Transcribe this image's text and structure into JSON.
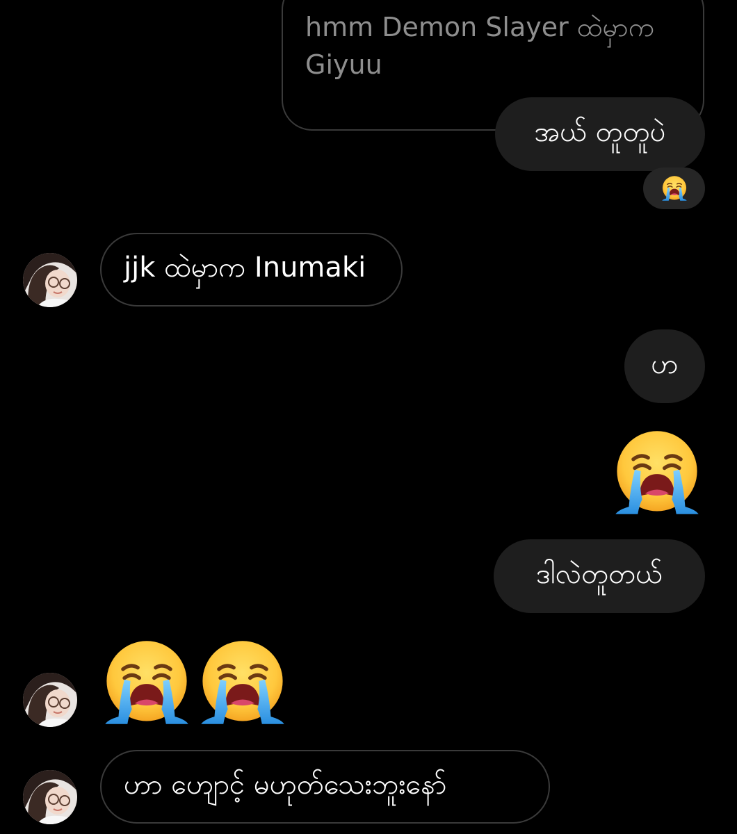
{
  "messages": {
    "quote_text": "hmm Demon Slayer ထဲမှာက\nGiyuu",
    "m1_text": "အယ် တူတူပဲ",
    "m2_text": "jjk ထဲမှာက Inumaki",
    "m3_text": "ဟ",
    "m4_text": "ဒါလဲတူတယ်",
    "m5_text": "ဟာ ဟျောင့် မဟုတ်သေးဘူးနော်"
  },
  "reactions": {
    "m1_reaction_icon": "loudly-crying-face-icon",
    "big_emoji_icon": "loudly-crying-face-icon",
    "double_emoji_icon": "loudly-crying-face-icon"
  },
  "colors": {
    "background": "#000000",
    "outgoing_bubble": "#1e1e1e",
    "outline": "#3a3a3a",
    "quote_text": "#8e8e8e",
    "reaction_pill": "#262626"
  }
}
